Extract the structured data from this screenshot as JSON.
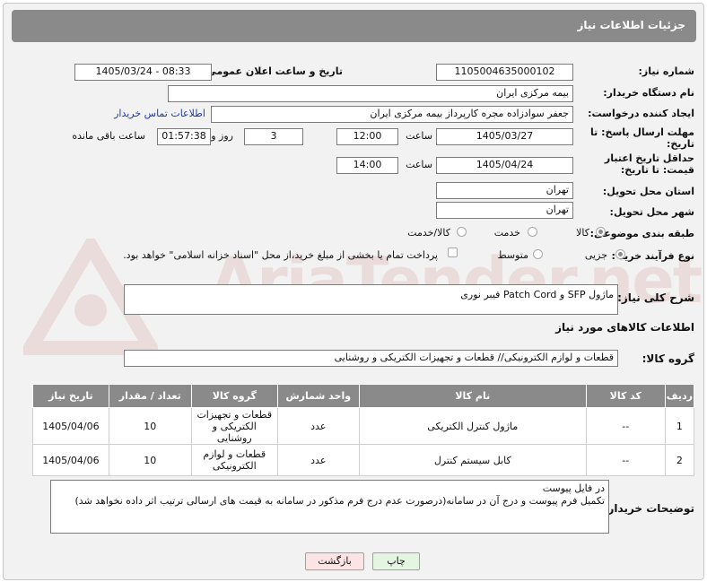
{
  "header": {
    "title": "جزئیات اطلاعات نیاز"
  },
  "fields": {
    "need_number_label": "شماره نیاز:",
    "need_number": "1105004635000102",
    "announce_label": "تاریخ و ساعت اعلان عمومی:",
    "announce_value": "1405/03/24 - 08:33",
    "buyer_org_label": "نام دستگاه خریدار:",
    "buyer_org": "بیمه مرکزی ایران",
    "creator_label": "ایجاد کننده درخواست:",
    "creator": "جعفر سوادزاده مجره کارپرداز بیمه مرکزی ایران",
    "contact_link": "اطلاعات تماس خریدار",
    "reply_deadline_label": "مهلت ارسال پاسخ: تا تاریخ:",
    "reply_date": "1405/03/27",
    "time_label": "ساعت",
    "reply_time": "12:00",
    "days": "3",
    "days_label": "روز و",
    "remaining": "01:57:38",
    "remaining_label": "ساعت باقی مانده",
    "price_validity_label": "حداقل تاریخ اعتبار قیمت: تا تاریخ:",
    "price_date": "1405/04/24",
    "price_time": "14:00",
    "province_label": "استان محل تحویل:",
    "province": "تهران",
    "city_label": "شهر محل تحویل:",
    "city": "تهران",
    "category_label": "طبقه بندی موضوعی:",
    "category_options": [
      "کالا",
      "خدمت",
      "کالا/خدمت"
    ],
    "process_label": "نوع فرآیند خرید :",
    "process_options": [
      "جزیی",
      "متوسط"
    ],
    "payment_note": "پرداخت تمام یا بخشی از مبلغ خرید،از محل \"اسناد خزانه اسلامی\" خواهد بود.",
    "description_label": "شرح کلی نیاز:",
    "description": "ماژول SFP و Patch Cord فیبر نوری",
    "goods_info_title": "اطلاعات کالاهای مورد نیاز",
    "goods_group_label": "گروه کالا:",
    "goods_group": "قطعات و لوازم الکترونیکی// قطعات و تجهیزات الکتریکی و روشنایی",
    "buyer_notes_label": "توضیحات خریدار:",
    "buyer_notes": "در فایل پیوست\nتکمیل فرم پیوست و درج آن در سامانه(درصورت عدم درج فرم مذکور در سامانه به قیمت های ارسالی ترتیب اثر داده نخواهد شد)"
  },
  "table": {
    "headers": [
      "ردیف",
      "کد کالا",
      "نام کالا",
      "واحد شمارش",
      "گروه کالا",
      "تعداد / مقدار",
      "تاریخ نیاز"
    ],
    "rows": [
      [
        "1",
        "--",
        "ماژول کنترل الکتریکی",
        "عدد",
        "قطعات و تجهیزات الکتریکی و روشنایی",
        "10",
        "1405/04/06"
      ],
      [
        "2",
        "--",
        "کابل سیستم کنترل",
        "عدد",
        "قطعات و لوازم الکترونیکی",
        "10",
        "1405/04/06"
      ]
    ]
  },
  "buttons": {
    "print": "چاپ",
    "back": "بازگشت"
  },
  "watermark": {
    "text": "AriaTender.net"
  },
  "colors": {
    "header_bg": "#8a8a8a",
    "print_btn": "#e4f5e1",
    "back_btn": "#fde4e4",
    "link": "#1a3ea8"
  }
}
